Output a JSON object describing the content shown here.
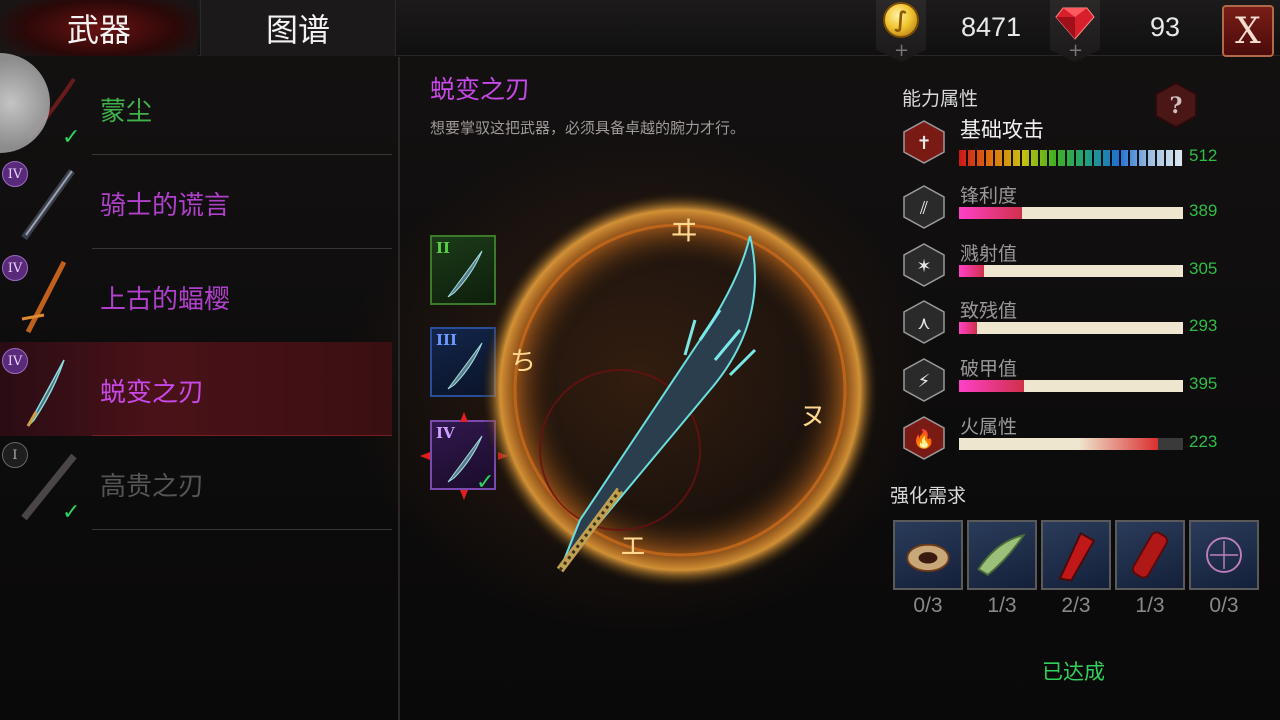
{
  "header": {
    "tabs": [
      {
        "label": "武器"
      },
      {
        "label": "图谱"
      }
    ],
    "gold": "8471",
    "gems": "93",
    "close_label": "X"
  },
  "weapon_list": [
    {
      "name": "蒙尘",
      "tier": "",
      "owned": true,
      "color": "#3fb24a"
    },
    {
      "name": "骑士的谎言",
      "tier": "IV",
      "owned": false,
      "color": "#b040cc"
    },
    {
      "name": "上古的蝠樱",
      "tier": "IV",
      "owned": false,
      "color": "#b040cc"
    },
    {
      "name": "蜕变之刃",
      "tier": "IV",
      "owned": false,
      "color": "#c848e8",
      "selected": true
    },
    {
      "name": "高贵之刃",
      "tier": "I",
      "owned": true,
      "color": "#555555"
    }
  ],
  "detail": {
    "title": "蜕变之刃",
    "description": "想要掌驭这把武器，必须具备卓越的腕力才行。",
    "variants": [
      "II",
      "III",
      "IV"
    ]
  },
  "attributes": {
    "heading": "能力属性",
    "stats": [
      {
        "label": "基础攻击",
        "value": "512",
        "fraction": 1.0
      },
      {
        "label": "锋利度",
        "value": "389",
        "fraction": 0.28
      },
      {
        "label": "溅射值",
        "value": "305",
        "fraction": 0.11
      },
      {
        "label": "致残值",
        "value": "293",
        "fraction": 0.08
      },
      {
        "label": "破甲值",
        "value": "395",
        "fraction": 0.29
      },
      {
        "label": "火属性",
        "value": "223",
        "fraction": 0.89
      }
    ]
  },
  "requirements": {
    "heading": "强化需求",
    "materials": [
      {
        "name": "bone-bracelet",
        "count": "0/3"
      },
      {
        "name": "green-lizard",
        "count": "1/3"
      },
      {
        "name": "red-arm",
        "count": "2/3"
      },
      {
        "name": "red-vial",
        "count": "1/3"
      },
      {
        "name": "dark-sigil",
        "count": "0/3"
      }
    ],
    "status": "已达成"
  },
  "colors": {
    "accent_purple": "#c848e8",
    "value_green": "#2fbd45",
    "close_red": "#7a1d17"
  }
}
